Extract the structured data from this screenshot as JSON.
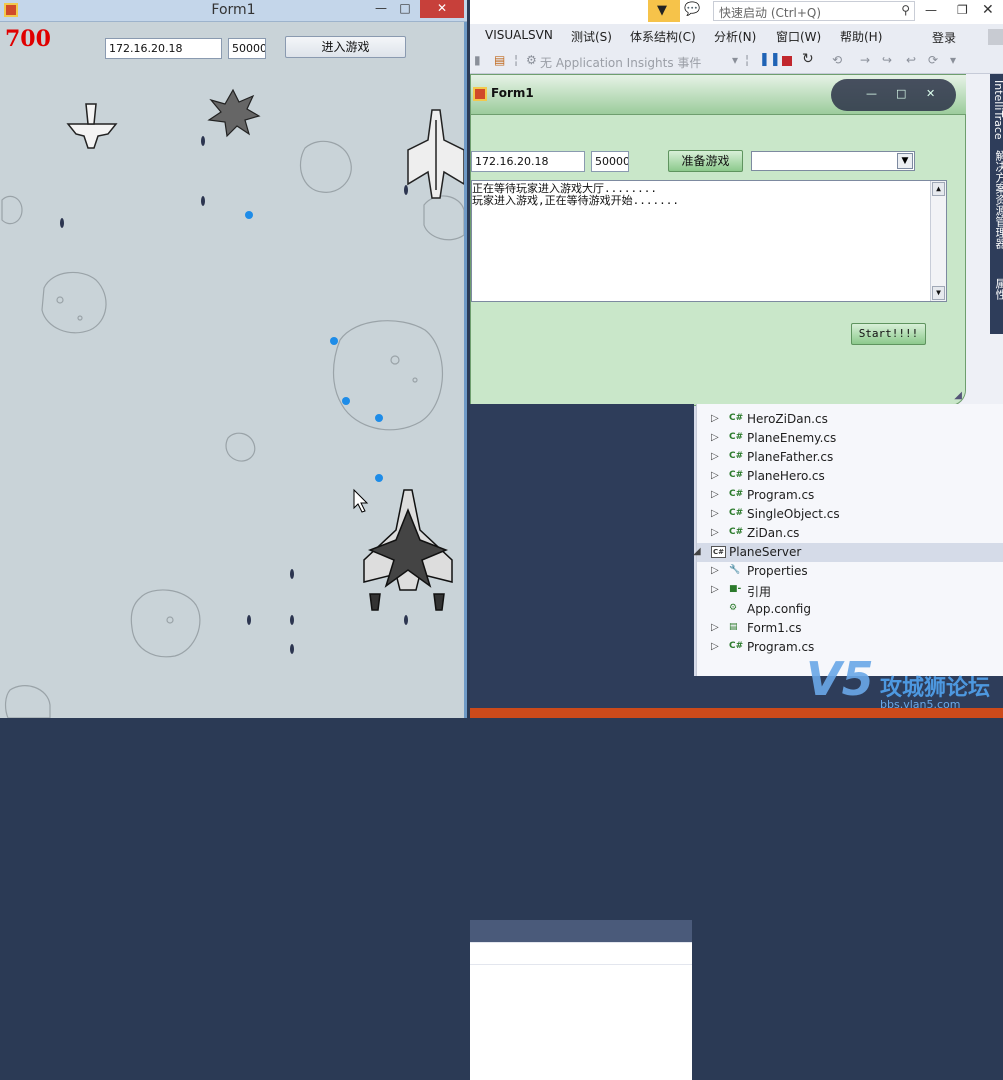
{
  "game": {
    "title": "Form1",
    "score": "700",
    "ip": "172.16.20.18",
    "port": "50000",
    "enter_button": "进入游戏",
    "controls": {
      "minimize": "—",
      "maximize": "□",
      "close": "✕"
    }
  },
  "vs": {
    "quick_launch": "快速启动 (Ctrl+Q)",
    "menu": [
      "VISUALSVN",
      "测试(S)",
      "体系结构(C)",
      "分析(N)",
      "窗口(W)",
      "帮助(H)"
    ],
    "login": "登录",
    "toolbar": {
      "insights": "无 Application Insights 事件"
    },
    "side_tabs": [
      "IntelliTrace",
      "解决方案资源管理器",
      "属性"
    ],
    "server_form": {
      "title": "Form1",
      "ip": "172.16.20.18",
      "port": "50000",
      "ready_button": "准备游戏",
      "log_lines": [
        "正在等待玩家进入游戏大厅........",
        "玩家进入游戏,正在等待游戏开始......."
      ],
      "start_button": "Start!!!!"
    },
    "solution_explorer": {
      "items": [
        {
          "label": "HeroZiDan.cs",
          "kind": "cs",
          "level": 2
        },
        {
          "label": "PlaneEnemy.cs",
          "kind": "cs",
          "level": 2
        },
        {
          "label": "PlaneFather.cs",
          "kind": "cs",
          "level": 2
        },
        {
          "label": "PlaneHero.cs",
          "kind": "cs",
          "level": 2
        },
        {
          "label": "Program.cs",
          "kind": "cs",
          "level": 2
        },
        {
          "label": "SingleObject.cs",
          "kind": "cs",
          "level": 2
        },
        {
          "label": "ZiDan.cs",
          "kind": "cs",
          "level": 2
        },
        {
          "label": "PlaneServer",
          "kind": "project",
          "level": 1,
          "selected": true
        },
        {
          "label": "Properties",
          "kind": "wrench",
          "level": 2
        },
        {
          "label": "引用",
          "kind": "ref",
          "level": 2
        },
        {
          "label": "App.config",
          "kind": "config",
          "level": 2
        },
        {
          "label": "Form1.cs",
          "kind": "form",
          "level": 2
        },
        {
          "label": "Program.cs",
          "kind": "cs",
          "level": 2
        }
      ]
    }
  },
  "watermark": {
    "brand": "V5",
    "text": "攻城狮论坛",
    "url": "bbs.vlan5.com"
  },
  "colors": {
    "score": "#e00000",
    "bullet": "#1e8ce8",
    "title_close": "#c7403a",
    "vs_accent": "#f6c34a"
  }
}
